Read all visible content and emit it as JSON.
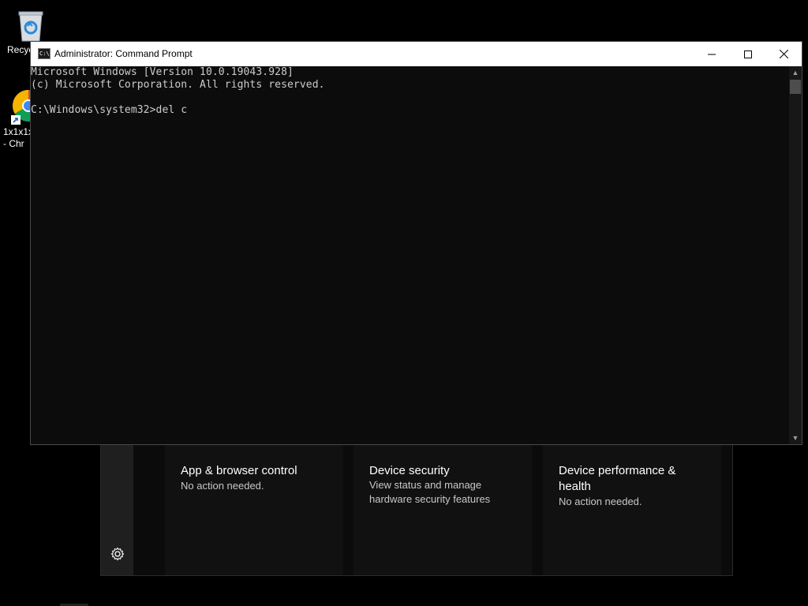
{
  "desktop": {
    "icons": [
      {
        "label": "Recyc",
        "icon": "recycle-bin-icon"
      },
      {
        "label": "1x1x1x\n- Chr",
        "icon": "chrome-icon"
      }
    ]
  },
  "cmd_window": {
    "title": "Administrator: Command Prompt",
    "app_icon_text": "C:\\",
    "console_lines": [
      "Microsoft Windows [Version 10.0.19043.928]",
      "(c) Microsoft Corporation. All rights reserved.",
      "C:\\Windows\\system32>del c"
    ],
    "colors": {
      "background": "#0c0c0c",
      "text": "#cccccc",
      "titlebar": "#ffffff"
    }
  },
  "security_window": {
    "tiles": [
      {
        "title": "App & browser control",
        "status": "No action needed."
      },
      {
        "title": "Device security",
        "status": "View status and manage hardware security features"
      },
      {
        "title": "Device performance & health",
        "status": "No action needed."
      }
    ],
    "settings_icon": "gear-icon",
    "colors": {
      "status_ok": "#2d6b2d"
    }
  }
}
